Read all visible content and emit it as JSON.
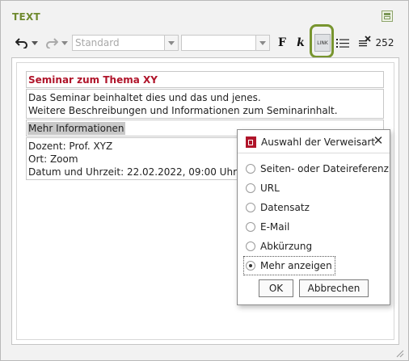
{
  "section": {
    "title": "TEXT"
  },
  "toolbar": {
    "style_select": "Standard",
    "font_select": "",
    "bold_label": "F",
    "italic_label": "k",
    "link_label": "LINK",
    "char_count": "252"
  },
  "editor": {
    "heading": "Seminar zum Thema XY",
    "paragraph_lines": [
      "Das Seminar beinhaltet dies und das und jenes.",
      "Weitere Beschreibungen und Informationen zum Seminarinhalt."
    ],
    "link_text": "Mehr Informationen",
    "detail_lines": [
      "Dozent: Prof. XYZ",
      "Ort: Zoom",
      "Datum und Uhrzeit: 22.02.2022, 09:00 Uhr"
    ]
  },
  "dialog": {
    "title": "Auswahl der Verweisart",
    "close_label": "✕",
    "options": [
      {
        "label": "Seiten- oder Dateireferenz",
        "checked": false
      },
      {
        "label": "URL",
        "checked": false
      },
      {
        "label": "Datensatz",
        "checked": false
      },
      {
        "label": "E-Mail",
        "checked": false
      },
      {
        "label": "Abkürzung",
        "checked": false
      },
      {
        "label": "Mehr anzeigen",
        "checked": true
      }
    ],
    "ok_label": "OK",
    "cancel_label": "Abbrechen"
  },
  "colors": {
    "accent_green": "#78952f",
    "heading_red": "#b0142a"
  }
}
